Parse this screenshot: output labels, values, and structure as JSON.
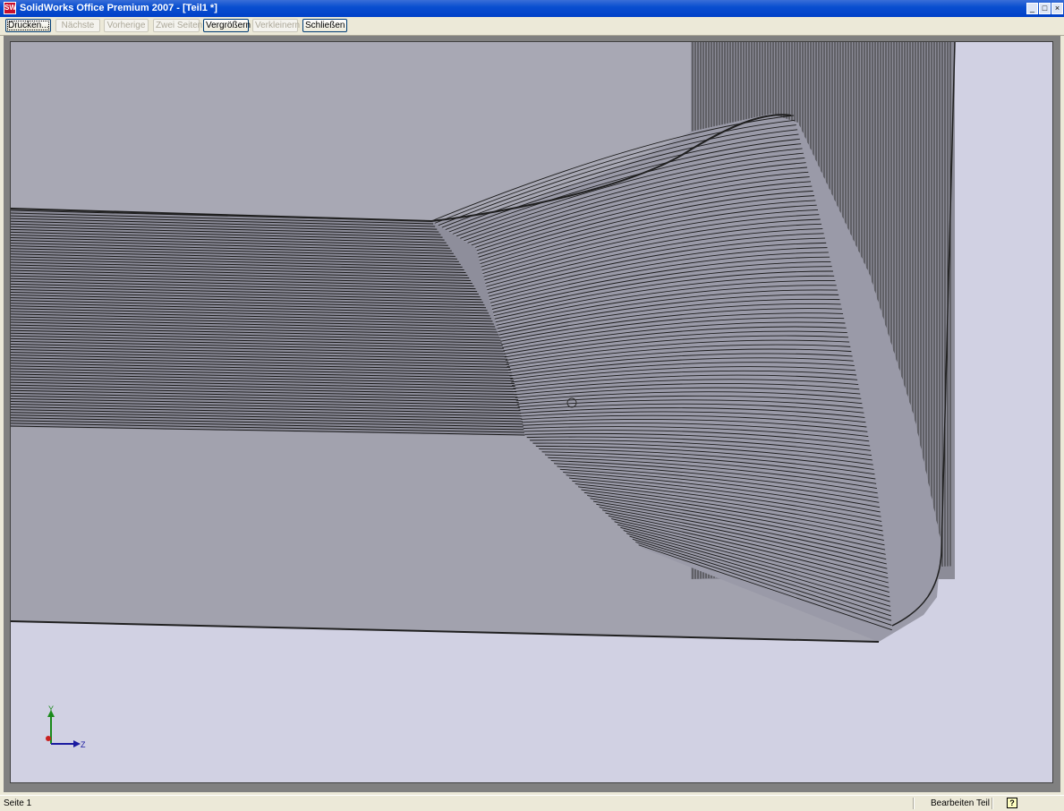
{
  "window": {
    "title": "SolidWorks Office Premium 2007 - [Teil1 *]",
    "app_icon_text": "SW",
    "minimize_glyph": "_",
    "maximize_glyph": "□",
    "close_glyph": "×"
  },
  "toolbar": {
    "buttons": [
      {
        "label": "Drucken...",
        "state": "enabled-default"
      },
      {
        "label": "Nächste",
        "state": "disabled"
      },
      {
        "label": "Vorherige",
        "state": "disabled"
      },
      {
        "label": "Zwei Seiten",
        "state": "disabled"
      },
      {
        "label": "Vergrößern",
        "state": "enabled"
      },
      {
        "label": "Verkleinern",
        "state": "disabled"
      },
      {
        "label": "Schließen",
        "state": "enabled"
      }
    ]
  },
  "viewport": {
    "background_color": "#d1d1e3",
    "part_color": "#a3a3b0",
    "triad": {
      "y_label": "Y",
      "z_label": "Z"
    }
  },
  "status": {
    "page": "Seite 1",
    "mode": "Bearbeiten Teil",
    "help_glyph": "?"
  }
}
